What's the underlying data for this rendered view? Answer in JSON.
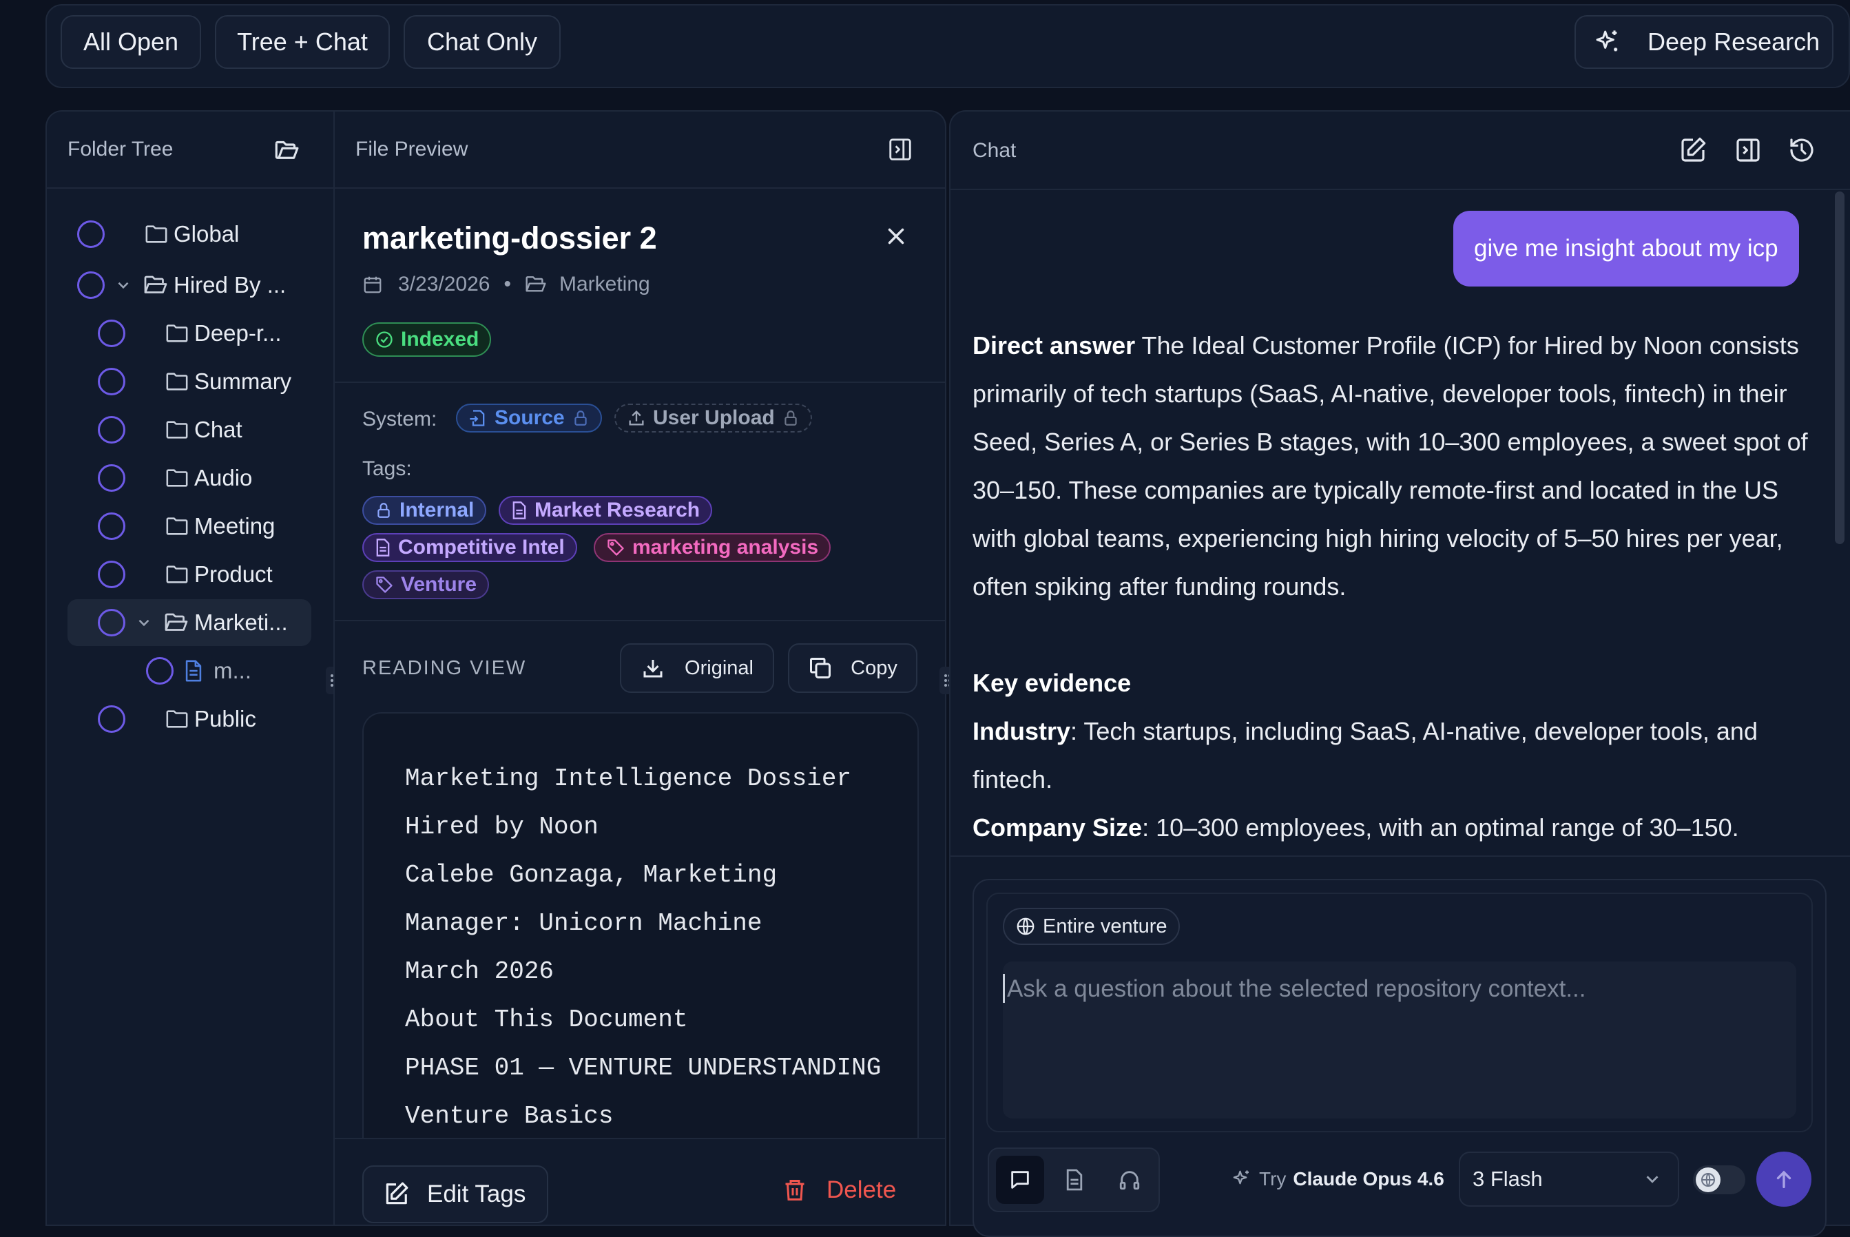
{
  "topbar": {
    "views": [
      "All Open",
      "Tree + Chat",
      "Chat Only"
    ],
    "deep_research": "Deep Research"
  },
  "folder_tree": {
    "title": "Folder Tree",
    "items": [
      {
        "label": "Global"
      },
      {
        "label": "Hired By ..."
      },
      {
        "label": "Deep-r..."
      },
      {
        "label": "Summary"
      },
      {
        "label": "Chat"
      },
      {
        "label": "Audio"
      },
      {
        "label": "Meeting"
      },
      {
        "label": "Product"
      },
      {
        "label": "Marketi..."
      },
      {
        "label": "m..."
      },
      {
        "label": "Public"
      }
    ]
  },
  "file_preview": {
    "title": "File Preview",
    "file_name": "marketing-dossier 2",
    "date": "3/23/2026",
    "separator": "•",
    "folder": "Marketing",
    "status": "Indexed",
    "system_label": "System:",
    "system_chips": [
      "Source",
      "User Upload"
    ],
    "tags_label": "Tags:",
    "tags": [
      "Internal",
      "Market Research",
      "Competitive Intel",
      "marketing analysis",
      "Venture"
    ],
    "reading_view": "READING VIEW",
    "original_btn": "Original",
    "copy_btn": "Copy",
    "content_lines": [
      "Marketing Intelligence Dossier",
      "Hired by Noon",
      "Calebe Gonzaga, Marketing",
      "Manager: Unicorn Machine",
      "March 2026",
      "About This Document",
      "PHASE 01 — VENTURE UNDERSTANDING",
      "Venture Basics"
    ],
    "edit_tags": "Edit Tags",
    "delete": "Delete"
  },
  "chat": {
    "title": "Chat",
    "user_message": "give me insight about my icp",
    "answer": {
      "direct_label": "Direct answer",
      "direct_text": " The Ideal Customer Profile (ICP) for Hired by Noon consists primarily of tech startups (SaaS, AI-native, developer tools, fintech) in their Seed, Series A, or Series B stages, with 10–300 employees, a sweet spot of 30–150. These companies are typically remote-first and located in the US with global teams, experiencing high hiring velocity of 5–50 hires per year, often spiking after funding rounds.",
      "key_evidence": "Key evidence",
      "industry_label": "Industry",
      "industry_text": ": Tech startups, including SaaS, AI-native, developer tools, and fintech.",
      "size_label": "Company Size",
      "size_text": ": 10–300 employees, with an optimal range of 30–150."
    },
    "scope_chip": "Entire venture",
    "input_placeholder": "Ask a question about the selected repository context...",
    "try_prefix": "Try",
    "try_model": "Claude Opus 4.6",
    "model_select": "3 Flash"
  },
  "colors": {
    "accent": "#7c5ce8",
    "indexed_green": "#4ade80",
    "delete_red": "#f0564f",
    "send_button": "#4b3fb8"
  }
}
